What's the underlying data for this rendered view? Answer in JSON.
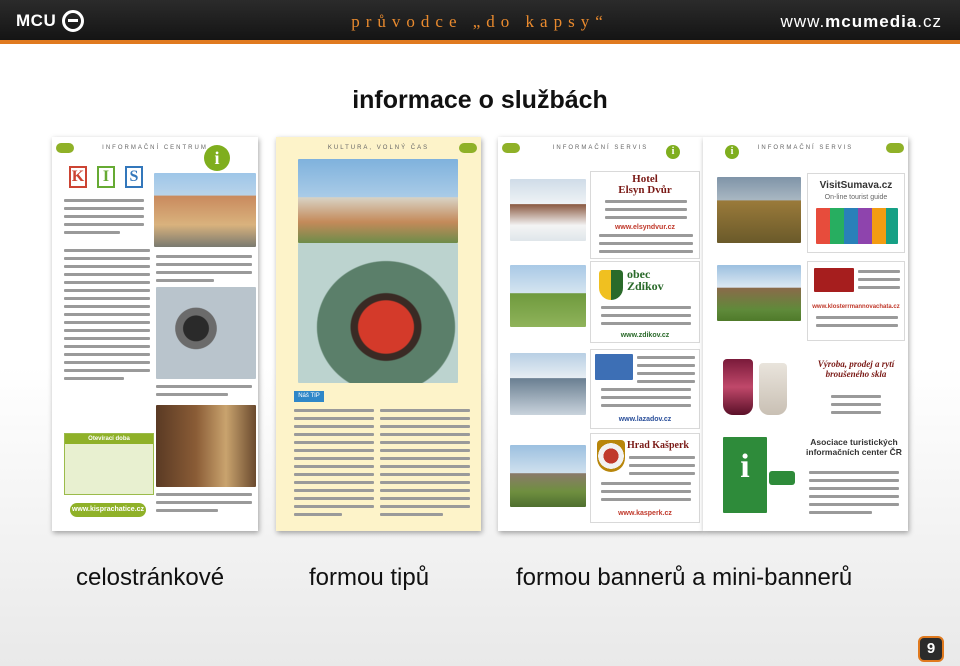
{
  "header": {
    "logo_text": "MCU",
    "logo_icon": "mcu-ring-icon",
    "title": "průvodce „do kapsy“",
    "website_prefix": "www.",
    "website_brand": "mcumedia",
    "website_suffix": ".cz",
    "accent_color": "#e07a1f"
  },
  "main": {
    "title": "informace o službách"
  },
  "sheets": {
    "kis": {
      "header": "INFORMAČNÍ CENTRUM",
      "info_badge": "i",
      "logo_letters": [
        "K",
        "I",
        "S"
      ],
      "panel_title": "Otevírací doba",
      "url": "www.kisprachatice.cz"
    },
    "tipy": {
      "header": "KULTURA, VOLNÝ ČAS",
      "tag": "Náš TIP"
    },
    "banner_left": {
      "header": "INFORMAČNÍ SERVIS",
      "hotel_title": "Hotel\nElsyn Dvůr",
      "hotel_url": "www.elsyndvur.cz",
      "obec_title": "obec\nZdíkov",
      "obec_url": "www.zdikov.cz",
      "lazadov_url": "www.lazadov.cz",
      "kasperk_title": "Hrad Kašperk",
      "kasperk_url": "www.kasperk.cz"
    },
    "banner_right": {
      "header": "INFORMAČNÍ SERVIS",
      "visit_title": "VisitSumava.cz",
      "visit_subtitle": "On-line tourist guide",
      "hotel2_url": "www.klosterrmannovachata.cz",
      "glass_text": "Výroba, prodej a rytí broušeného skla",
      "atic_title": "Asociace turistických informačních center ČR"
    }
  },
  "captions": {
    "full_page": "celostránkové",
    "tips": "formou tipů",
    "banners": "formou bannerů a mini-bannerů"
  },
  "slide_number": "9"
}
